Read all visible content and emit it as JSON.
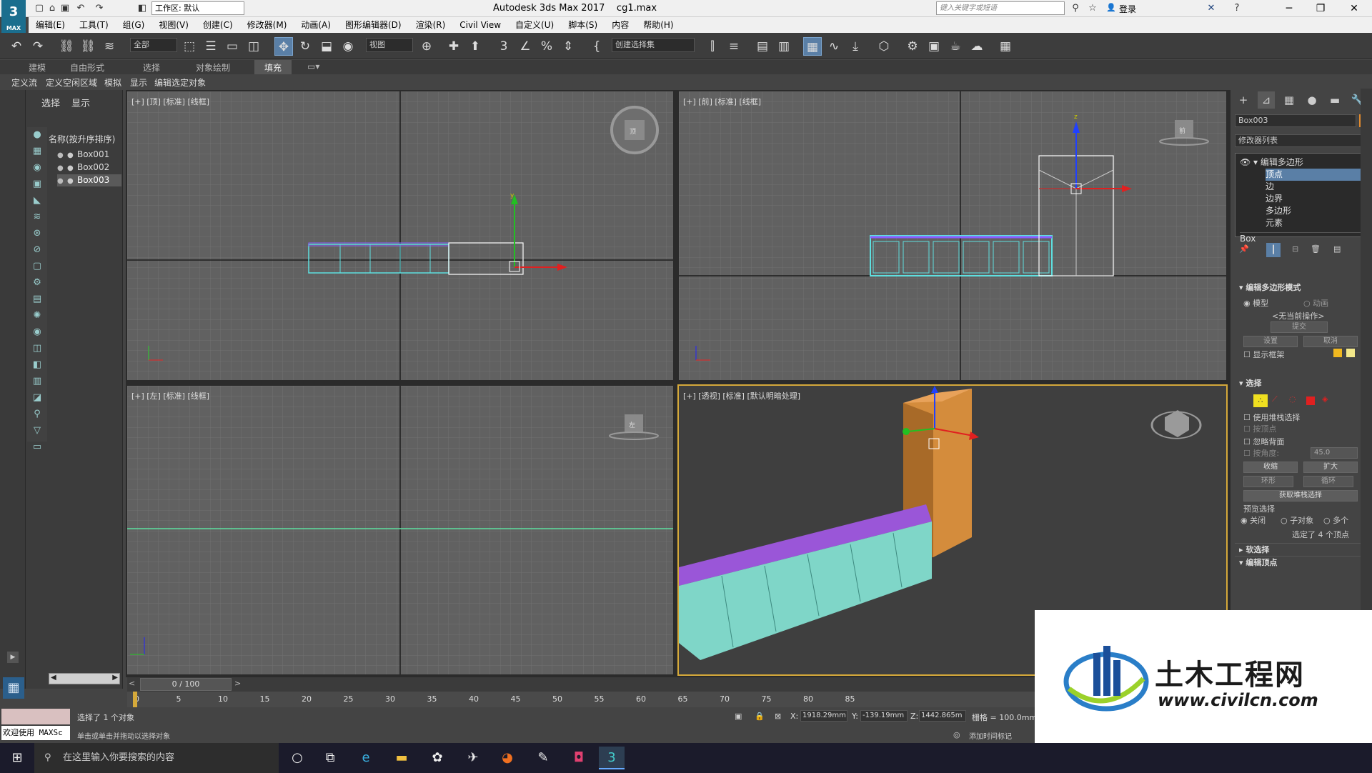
{
  "titlebar": {
    "logo": "3",
    "logo_sub": "MAX",
    "workspace": "工作区: 默认",
    "app_title": "Autodesk 3ds Max 2017",
    "file_name": "cg1.max",
    "search_placeholder": "键入关键字或短语",
    "login": "登录",
    "minimize": "─",
    "maximize": "❐",
    "close": "✕"
  },
  "menu": [
    "编辑(E)",
    "工具(T)",
    "组(G)",
    "视图(V)",
    "创建(C)",
    "修改器(M)",
    "动画(A)",
    "图形编辑器(D)",
    "渲染(R)",
    "Civil View",
    "自定义(U)",
    "脚本(S)",
    "内容",
    "帮助(H)"
  ],
  "toolbar": {
    "filter": "全部",
    "ref_coord": "视图",
    "named_sel": "创建选择集"
  },
  "ribbon": {
    "tabs": [
      "建模",
      "自由形式",
      "选择",
      "对象绘制",
      "填充"
    ],
    "active": "填充",
    "sub": [
      "定义流",
      "定义空闲区域",
      "模拟",
      "显示",
      "编辑选定对象"
    ]
  },
  "scene": {
    "tabs": [
      "选择",
      "显示"
    ],
    "header": "名称(按升序排序)",
    "items": [
      {
        "name": "Box001",
        "selected": false
      },
      {
        "name": "Box002",
        "selected": false
      },
      {
        "name": "Box003",
        "selected": true
      }
    ],
    "eye": "●",
    "dot": "●"
  },
  "viewports": {
    "top": "[+] [顶] [标准] [线框]",
    "front": "[+] [前] [标准] [线框]",
    "left": "[+] [左] [标准] [线框]",
    "persp": "[+] [透视] [标准] [默认明暗处理]"
  },
  "cmd": {
    "tabs": [
      "+",
      "⊿",
      "▦",
      "●",
      "▬",
      "🔧"
    ],
    "object_name": "Box003",
    "object_color": "#e08a2e",
    "modlist": "修改器列表",
    "stack": [
      {
        "label": "编辑多边形",
        "sel": false,
        "indent": 0
      },
      {
        "label": "顶点",
        "sel": true,
        "indent": 1
      },
      {
        "label": "边",
        "sel": false,
        "indent": 1
      },
      {
        "label": "边界",
        "sel": false,
        "indent": 1
      },
      {
        "label": "多边形",
        "sel": false,
        "indent": 1
      },
      {
        "label": "元素",
        "sel": false,
        "indent": 1
      },
      {
        "label": "Box",
        "sel": false,
        "indent": -1
      }
    ],
    "mode_header": "编辑多边形模式",
    "model": "模型",
    "animation": "动画",
    "no_op": "<无当前操作>",
    "commit": "提交",
    "settings": "设置",
    "cancel": "取消",
    "show_cage": "显示框架",
    "select_header": "选择",
    "use_stack": "使用堆栈选择",
    "by_vertex": "按顶点",
    "ignore_back": "忽略背面",
    "by_angle": "按角度:",
    "angle_val": "45.0",
    "shrink": "收缩",
    "grow": "扩大",
    "ring": "环形",
    "loop": "循环",
    "get_stack": "获取堆栈选择",
    "preview": "预览选择",
    "off": "关闭",
    "subobj": "子对象",
    "multi": "多个",
    "selected_info": "选定了 4 个顶点",
    "soft_header": "软选择",
    "edit_vert_header": "编辑顶点"
  },
  "timeline": {
    "frame": "0 / 100",
    "ticks": [
      "0",
      "5",
      "10",
      "15",
      "20",
      "25",
      "30",
      "35",
      "40",
      "45",
      "50",
      "55",
      "60",
      "65",
      "70",
      "75",
      "80",
      "85"
    ]
  },
  "status": {
    "maxscript": "欢迎使用 MAXSc",
    "selected": "选择了 1 个对象",
    "hint": "单击或单击并拖动以选择对象",
    "x_label": "X:",
    "x": "1918.29mm",
    "y_label": "Y:",
    "y": "-139.19mm",
    "z_label": "Z:",
    "z": "1442.865m",
    "grid": "栅格 = 100.0mm",
    "add_time_tag": "添加时间标记"
  },
  "taskbar": {
    "search": "在这里输入你要搜索的内容"
  },
  "watermark": {
    "brand": "土木工程网",
    "url": "www.civilcn.com"
  }
}
